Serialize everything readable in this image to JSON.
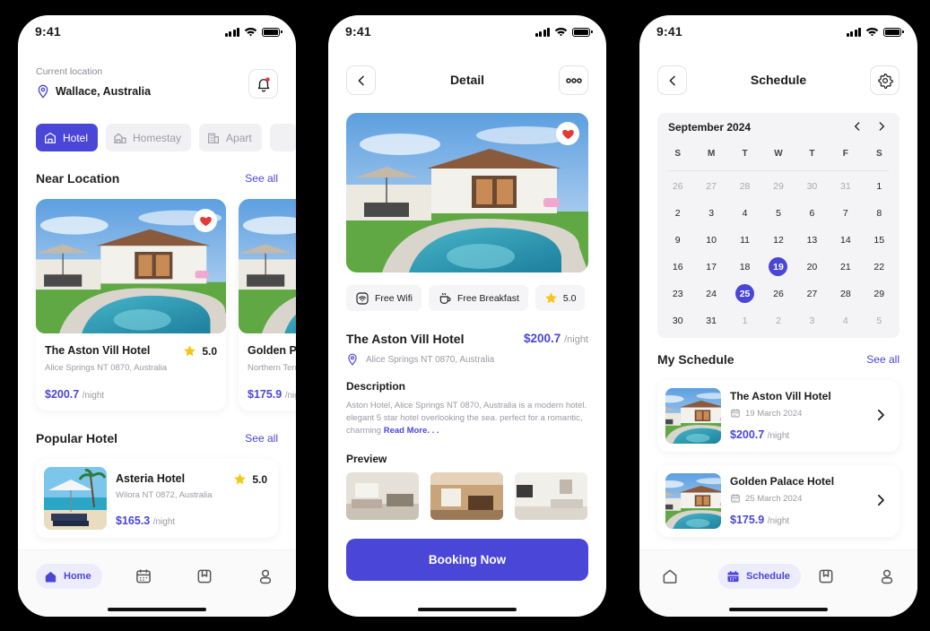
{
  "status": {
    "time": "9:41"
  },
  "home": {
    "location_label": "Current location",
    "location_value": "Wallace, Australia",
    "categories": [
      {
        "label": "Hotel",
        "icon": "hotel-icon"
      },
      {
        "label": "Homestay",
        "icon": "homestay-icon"
      },
      {
        "label": "Apart",
        "icon": "apartment-icon"
      }
    ],
    "near_title": "Near Location",
    "see_all": "See all",
    "near": [
      {
        "name": "The Aston Vill Hotel",
        "address": "Alice Springs NT 0870, Australia",
        "price": "$200.7",
        "per": "/night",
        "rating": "5.0"
      },
      {
        "name": "Golden Palace Hotel",
        "address": "Northern Territory",
        "price": "$175.9",
        "per": "/night"
      }
    ],
    "popular_title": "Popular Hotel",
    "popular": {
      "name": "Asteria Hotel",
      "address": "Wilora NT 0872, Australia",
      "price": "$165.3",
      "per": "/night",
      "rating": "5.0"
    },
    "tabs": {
      "home": "Home"
    }
  },
  "detail": {
    "title": "Detail",
    "chips": [
      {
        "label": "Free Wifi",
        "icon": "wifi-icon"
      },
      {
        "label": "Free Breakfast",
        "icon": "coffee-icon"
      },
      {
        "label": "5.0",
        "icon": "star-icon"
      }
    ],
    "name": "The Aston Vill Hotel",
    "price": "$200.7",
    "per": "/night",
    "address": "Alice Springs NT 0870, Australia",
    "description_title": "Description",
    "description": "Aston Hotel, Alice Springs NT 0870, Australia is a modern hotel. elegant 5 star hotel overlooking the sea. perfect for a romantic, charming ",
    "read_more": "Read More. . .",
    "preview_title": "Preview",
    "book_button": "Booking Now"
  },
  "schedule": {
    "title": "Schedule",
    "month": "September 2024",
    "weekdays": [
      "S",
      "M",
      "T",
      "W",
      "T",
      "F",
      "S"
    ],
    "days": [
      "26",
      "27",
      "28",
      "29",
      "30",
      "31",
      "1",
      "2",
      "3",
      "4",
      "5",
      "6",
      "7",
      "8",
      "9",
      "10",
      "11",
      "12",
      "13",
      "14",
      "15",
      "16",
      "17",
      "18",
      "19",
      "20",
      "21",
      "22",
      "23",
      "24",
      "25",
      "26",
      "27",
      "28",
      "29",
      "30",
      "31",
      "1",
      "2",
      "3",
      "4",
      "5"
    ],
    "dim_indices": [
      0,
      1,
      2,
      3,
      4,
      5,
      37,
      38,
      39,
      40,
      41
    ],
    "selected_indices": [
      24,
      30
    ],
    "my_schedule_title": "My Schedule",
    "see_all": "See all",
    "items": [
      {
        "name": "The Aston Vill Hotel",
        "date": "19 March 2024",
        "price": "$200.7",
        "per": "/night"
      },
      {
        "name": "Golden Palace Hotel",
        "date": "25 March 2024",
        "price": "$175.9",
        "per": "/night"
      }
    ],
    "tabs": {
      "schedule": "Schedule"
    }
  },
  "colors": {
    "accent": "#4a46d8",
    "heart": "#e53935",
    "star": "#f5c518"
  }
}
